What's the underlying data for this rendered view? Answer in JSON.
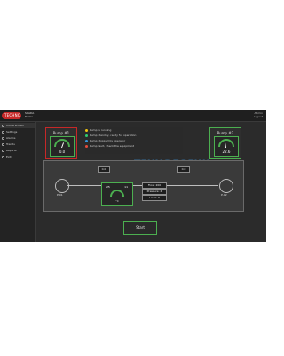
{
  "header": {
    "logo_text": "TECHNO",
    "title_line1": "SCADA",
    "title_line2": "Demo",
    "right_line1": "Admin",
    "right_line2": "Logout"
  },
  "sidebar": {
    "items": [
      {
        "label": "Home screen",
        "icon": "home-icon"
      },
      {
        "label": "Settings",
        "icon": "gear-icon"
      },
      {
        "label": "Alarms",
        "icon": "bell-icon"
      },
      {
        "label": "Trends",
        "icon": "chart-icon"
      },
      {
        "label": "Reports",
        "icon": "report-icon"
      },
      {
        "label": "Exit",
        "icon": "exit-icon"
      }
    ]
  },
  "panels": {
    "left": {
      "title": "Pump #1",
      "value": "0.0"
    },
    "right": {
      "title": "Pump #2",
      "value": "22.6"
    }
  },
  "notes": [
    {
      "text": "Pump is running",
      "color": "#f1c40f"
    },
    {
      "text": "Pump standby, ready for operation",
      "color": "#2ecc71"
    },
    {
      "text": "Pump stopped by operator",
      "color": "#3498db"
    },
    {
      "text": "Pump fault, check the equipment",
      "color": "#e74c3c"
    }
  ],
  "scene": {
    "left_circle_label": "P-01",
    "right_circle_label": "P-02",
    "tag_left": "0.0",
    "tag_right": "0.0",
    "center_value_left": "25",
    "center_value_right": "11",
    "center_unit": "°C",
    "pipe_label_1": "Flow: 200",
    "pipe_label_2": "Pressure: 4",
    "pipe_label_3": "Level: 0",
    "watermark": "ТЕХНОЛОГИИ ОПЕРАЦИЙ"
  },
  "bottom_button": {
    "label": "Start"
  },
  "colors": {
    "accent": "#4caf50",
    "danger": "#c62828"
  }
}
